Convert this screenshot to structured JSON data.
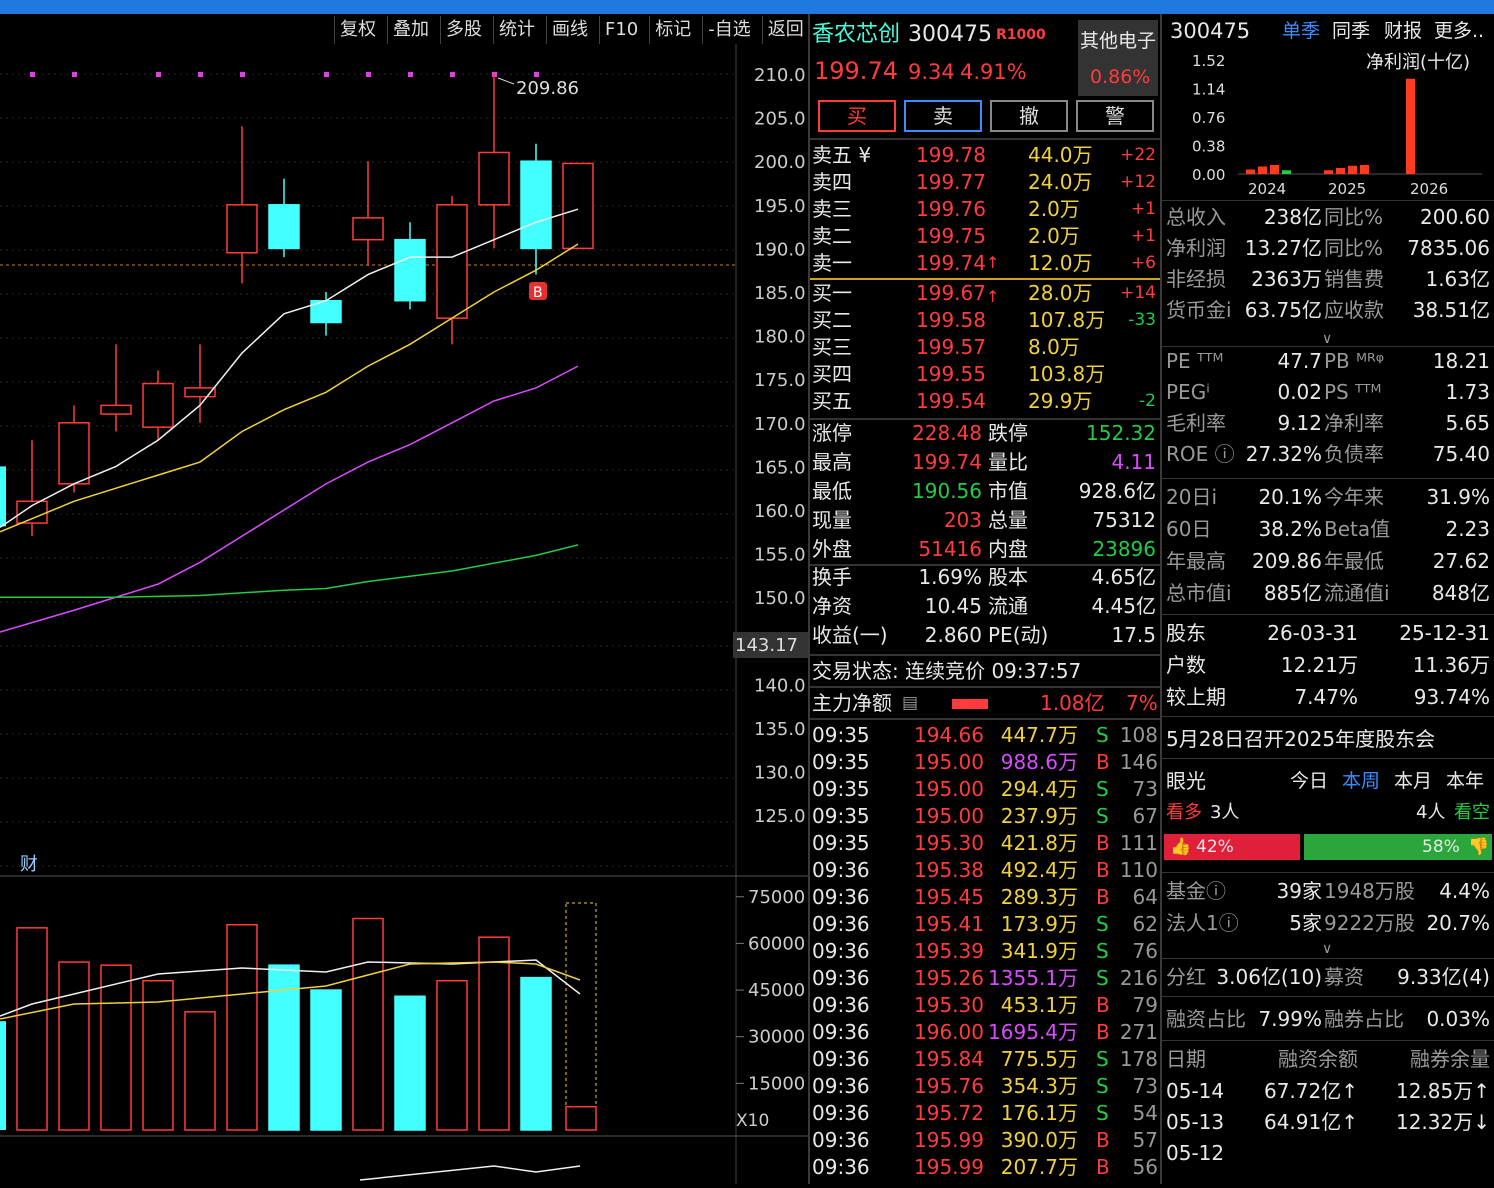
{
  "toolbar": [
    "复权",
    "叠加",
    "多股",
    "统计",
    "画线",
    "F10",
    "标记",
    "-自选",
    "返回"
  ],
  "chart": {
    "price_axis": [
      "210.0",
      "205.0",
      "200.0",
      "195.0",
      "190.0",
      "185.0",
      "180.0",
      "175.0",
      "170.0",
      "165.0",
      "160.0",
      "155.0",
      "150.0",
      "140.0",
      "135.0",
      "130.0",
      "125.0"
    ],
    "current_axis": "143.17",
    "high_label": "209.86",
    "buy_marker": "B",
    "fin_marker": "财",
    "vol_axis": [
      "75000",
      "60000",
      "45000",
      "30000",
      "15000"
    ],
    "vol_mult": "X10"
  },
  "quote": {
    "name": "香农芯创",
    "code": "300475",
    "tag": "R1000",
    "price": "199.74",
    "change": "9.34",
    "pct": "4.91%",
    "sector": "其他电子",
    "sector_pct": "0.86%"
  },
  "buttons": [
    "买",
    "卖",
    "撤",
    "警"
  ],
  "sells": [
    {
      "l": "卖五 ¥",
      "p": "199.78",
      "v": "44.0万",
      "d": "+22"
    },
    {
      "l": "卖四",
      "p": "199.77",
      "v": "24.0万",
      "d": "+12"
    },
    {
      "l": "卖三",
      "p": "199.76",
      "v": "2.0万",
      "d": "+1"
    },
    {
      "l": "卖二",
      "p": "199.75",
      "v": "2.0万",
      "d": "+1"
    },
    {
      "l": "卖一",
      "p": "199.74",
      "v": "12.0万",
      "d": "+6"
    }
  ],
  "buys": [
    {
      "l": "买一",
      "p": "199.67",
      "v": "28.0万",
      "d": "+14"
    },
    {
      "l": "买二",
      "p": "199.58",
      "v": "107.8万",
      "d": "-33"
    },
    {
      "l": "买三",
      "p": "199.57",
      "v": "8.0万",
      "d": ""
    },
    {
      "l": "买四",
      "p": "199.55",
      "v": "103.8万",
      "d": ""
    },
    {
      "l": "买五",
      "p": "199.54",
      "v": "29.9万",
      "d": "-2"
    }
  ],
  "stats": [
    [
      "涨停",
      "228.48",
      "跌停",
      "152.32"
    ],
    [
      "最高",
      "199.74",
      "量比",
      "4.11"
    ],
    [
      "最低",
      "190.56",
      "市值",
      "928.6亿"
    ],
    [
      "现量",
      "203",
      "总量",
      "75312"
    ],
    [
      "外盘",
      "51416",
      "内盘",
      "23896"
    ]
  ],
  "stats2": [
    [
      "换手",
      "1.69%",
      "股本",
      "4.65亿"
    ],
    [
      "净资",
      "10.45",
      "流通",
      "4.45亿"
    ],
    [
      "收益(一)",
      "2.860",
      "PE(动)",
      "17.5"
    ]
  ],
  "status": "交易状态: 连续竞价 09:37:57",
  "mainflow": {
    "label": "主力净额",
    "value": "1.08亿",
    "pct": "7%"
  },
  "ticks": [
    [
      "09:35",
      "194.66",
      "447.7万",
      "S",
      "108"
    ],
    [
      "09:35",
      "195.00",
      "988.6万",
      "B",
      "146"
    ],
    [
      "09:35",
      "195.00",
      "294.4万",
      "S",
      "73"
    ],
    [
      "09:35",
      "195.00",
      "237.9万",
      "S",
      "67"
    ],
    [
      "09:35",
      "195.30",
      "421.8万",
      "B",
      "111"
    ],
    [
      "09:36",
      "195.38",
      "492.4万",
      "B",
      "110"
    ],
    [
      "09:36",
      "195.45",
      "289.3万",
      "B",
      "64"
    ],
    [
      "09:36",
      "195.41",
      "173.9万",
      "S",
      "62"
    ],
    [
      "09:36",
      "195.39",
      "341.9万",
      "S",
      "76"
    ],
    [
      "09:36",
      "195.26",
      "1355.1万",
      "S",
      "216"
    ],
    [
      "09:36",
      "195.30",
      "453.1万",
      "B",
      "79"
    ],
    [
      "09:36",
      "196.00",
      "1695.4万",
      "B",
      "271"
    ],
    [
      "09:36",
      "195.84",
      "775.5万",
      "S",
      "178"
    ],
    [
      "09:36",
      "195.76",
      "354.3万",
      "S",
      "73"
    ],
    [
      "09:36",
      "195.72",
      "176.1万",
      "S",
      "54"
    ],
    [
      "09:36",
      "195.99",
      "390.0万",
      "B",
      "57"
    ],
    [
      "09:36",
      "195.99",
      "207.7万",
      "B",
      "56"
    ]
  ],
  "fin": {
    "code": "300475",
    "tabs": [
      "单季",
      "同季",
      "财报",
      "更多.."
    ],
    "chart_title": "净利润(十亿)",
    "yaxis": [
      "1.52",
      "1.14",
      "0.76",
      "0.38",
      "0.00"
    ],
    "xaxis": [
      "2024",
      "2025",
      "2026"
    ],
    "chart_data": {
      "type": "bar",
      "title": "净利润(十亿)",
      "ylim": [
        0,
        1.52
      ],
      "values": [
        0.06,
        0.1,
        0.12,
        0.05,
        0.05,
        0.08,
        0.11,
        0.12,
        1.27
      ],
      "x": [
        "2024",
        "2025",
        "2026"
      ]
    },
    "rows1": [
      [
        "总收入",
        "238亿",
        "同比%",
        "200.60"
      ],
      [
        "净利润",
        "13.27亿",
        "同比%",
        "7835.06"
      ],
      [
        "非经损",
        "2363万",
        "销售费",
        "1.63亿"
      ],
      [
        "货币金i",
        "63.75亿",
        "应收款",
        "38.51亿"
      ]
    ],
    "rows2": [
      [
        "PE ᵀᵀᴹ",
        "47.7",
        "PB ᴹᴿᵠ",
        "18.21"
      ],
      [
        "PEGⁱ",
        "0.02",
        "PS ᵀᵀᴹ",
        "1.73"
      ],
      [
        "毛利率",
        "9.12",
        "净利率",
        "5.65"
      ],
      [
        "ROE ⓘ",
        "27.32%",
        "负债率",
        "75.40"
      ]
    ],
    "rows3": [
      [
        "20日i",
        "20.1%",
        "今年来",
        "31.9%"
      ],
      [
        "60日",
        "38.2%",
        "Beta值",
        "2.23"
      ],
      [
        "年最高",
        "209.86",
        "年最低",
        "27.62"
      ],
      [
        "总市值i",
        "885亿",
        "流通值i",
        "848亿"
      ]
    ],
    "rows4": [
      [
        "股东",
        "26-03-31",
        "25-12-31"
      ],
      [
        "户数",
        "12.21万",
        "11.36万"
      ],
      [
        "较上期",
        "7.47%",
        "93.74%"
      ]
    ],
    "notice": "5月28日召开2025年度股东会",
    "eye": {
      "label": "眼光",
      "tabs": [
        "今日",
        "本周",
        "本月",
        "本年"
      ],
      "bull": "看多",
      "bull_n": "3人",
      "bear_n": "4人",
      "bear": "看空",
      "bull_pct": "42%",
      "bear_pct": "58%"
    },
    "fund": [
      [
        "基金ⓘ",
        "39家",
        "1948万股",
        "4.4%"
      ],
      [
        "法人1ⓘ",
        "5家",
        "9222万股",
        "20.7%"
      ]
    ],
    "div": [
      "分红",
      "3.06亿(10)",
      "募资",
      "9.33亿(4)"
    ],
    "margin": [
      "融资占比",
      "7.99%",
      "融券占比",
      "0.03%"
    ],
    "mtable": {
      "head": [
        "日期",
        "融资余额",
        "融券余量"
      ],
      "rows": [
        [
          "05-14",
          "67.72亿↑",
          "12.85万↑"
        ],
        [
          "05-13",
          "64.91亿↑",
          "12.32万↓"
        ],
        [
          "05-12",
          "",
          ""
        ]
      ]
    }
  }
}
